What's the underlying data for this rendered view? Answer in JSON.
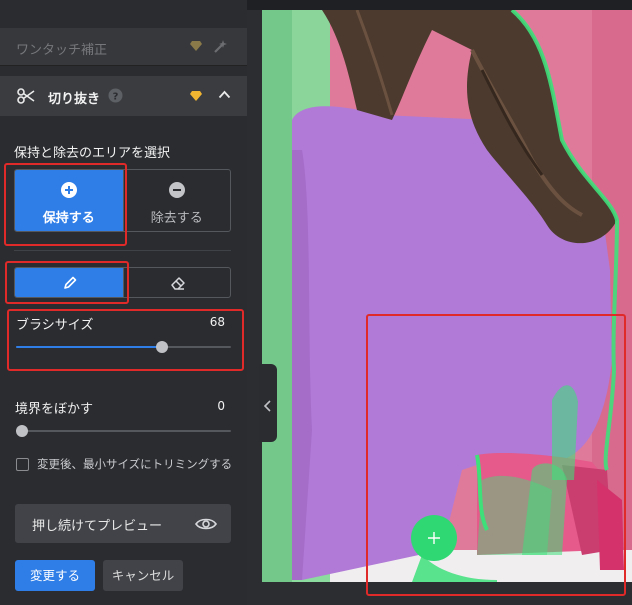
{
  "panel": {
    "one_touch_label": "ワンタッチ補正",
    "crop_label": "切り抜き",
    "area_title": "保持と除去のエリアを選択",
    "keep_label": "保持する",
    "remove_label": "除去する",
    "brush_size_label": "ブラシサイズ",
    "brush_size_value": "68",
    "brush_size_fraction": 0.68,
    "feather_label": "境界をぼかす",
    "feather_value": "0",
    "feather_fraction": 0.0,
    "trim_label": "変更後、最小サイズにトリミングする",
    "preview_label": "押し続けてプレビュー",
    "apply_label": "変更する",
    "cancel_label": "キャンセル"
  },
  "icons": {
    "scissors": "scissors-icon",
    "help": "help-icon",
    "premium": "diamond-icon",
    "wand": "magic-wand-icon",
    "collapse": "chevron-up-icon",
    "plus": "plus-circle-icon",
    "minus": "minus-circle-icon",
    "brush": "pencil-icon",
    "eraser": "eraser-icon",
    "eye": "eye-icon",
    "panel_toggle": "chevron-left-icon",
    "brush_cursor": "plus-icon"
  },
  "colors": {
    "accent": "#2f7ee8",
    "premium": "#f2b531",
    "keep_mask": "#3ee07a",
    "highlight": "#e02a2a"
  }
}
